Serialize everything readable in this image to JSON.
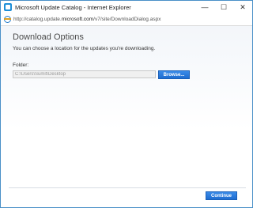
{
  "window": {
    "title": "Microsoft Update Catalog - Internet Explorer",
    "controls": {
      "minimize": "—",
      "maximize": "☐",
      "close": "✕"
    }
  },
  "address": {
    "prefix": "http://catalog.update.",
    "host": "microsoft.com",
    "path": "/v7/site/DownloadDialog.aspx"
  },
  "dialog": {
    "heading": "Download Options",
    "description": "You can choose a location for the updates you're downloading.",
    "folder_label": "Folder:",
    "folder_value": "C:\\Users\\Sumit\\Desktop",
    "browse_label": "Browse...",
    "continue_label": "Continue"
  },
  "colors": {
    "accent": "#1e6cd0",
    "window_border": "#4a90c8"
  },
  "icons": {
    "app": "internet-explorer-icon",
    "address": "ie-page-icon"
  }
}
